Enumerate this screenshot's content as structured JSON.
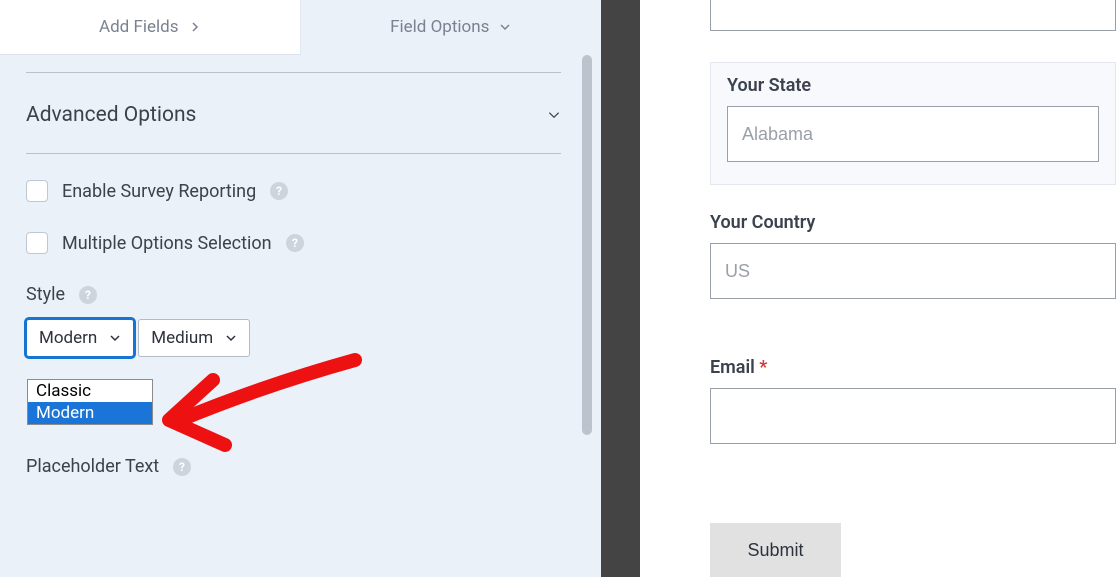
{
  "tabs": {
    "add_fields": "Add Fields",
    "field_options": "Field Options"
  },
  "advanced": {
    "title": "Advanced Options",
    "enable_survey": "Enable Survey Reporting",
    "multiple_options": "Multiple Options Selection",
    "style_label": "Style",
    "style_selected": "Modern",
    "style_options": {
      "classic": "Classic",
      "modern": "Modern"
    },
    "size_selected": "Medium",
    "placeholder_label": "Placeholder Text"
  },
  "preview": {
    "state_label": "Your State",
    "state_placeholder": "Alabama",
    "country_label": "Your Country",
    "country_placeholder": "US",
    "email_label": "Email",
    "submit": "Submit"
  }
}
